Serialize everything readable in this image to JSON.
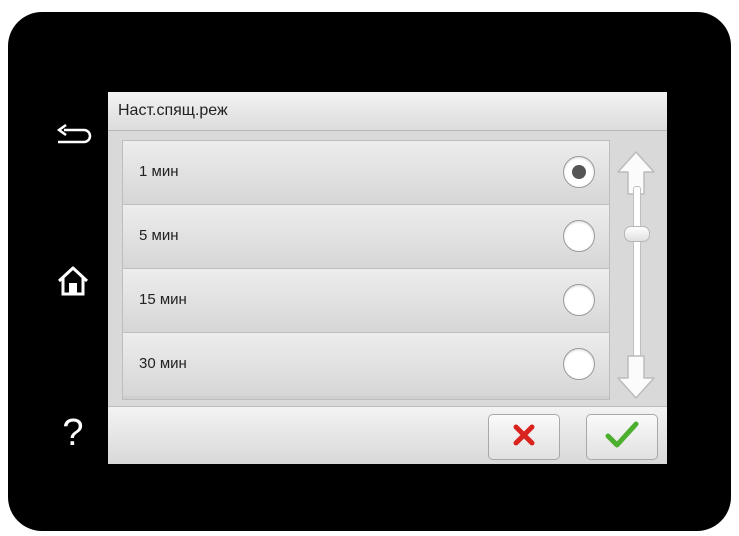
{
  "screen": {
    "title": "Наст.спящ.реж"
  },
  "options": [
    {
      "label": "1 мин",
      "selected": true
    },
    {
      "label": "5 мин",
      "selected": false
    },
    {
      "label": "15 мин",
      "selected": false
    },
    {
      "label": "30 мин",
      "selected": false
    }
  ],
  "side_buttons": {
    "help_label": "?"
  },
  "icons": {
    "back": "back-arrow-icon",
    "home": "home-icon",
    "help": "question-mark-icon",
    "scroll_up": "arrow-up-icon",
    "scroll_down": "arrow-down-icon",
    "cancel": "close-icon",
    "confirm": "checkmark-icon"
  },
  "colors": {
    "cancel_icon": "#d9231f",
    "confirm_icon": "#4caf2e",
    "bezel": "#000000",
    "selected_radio": "#555555"
  }
}
